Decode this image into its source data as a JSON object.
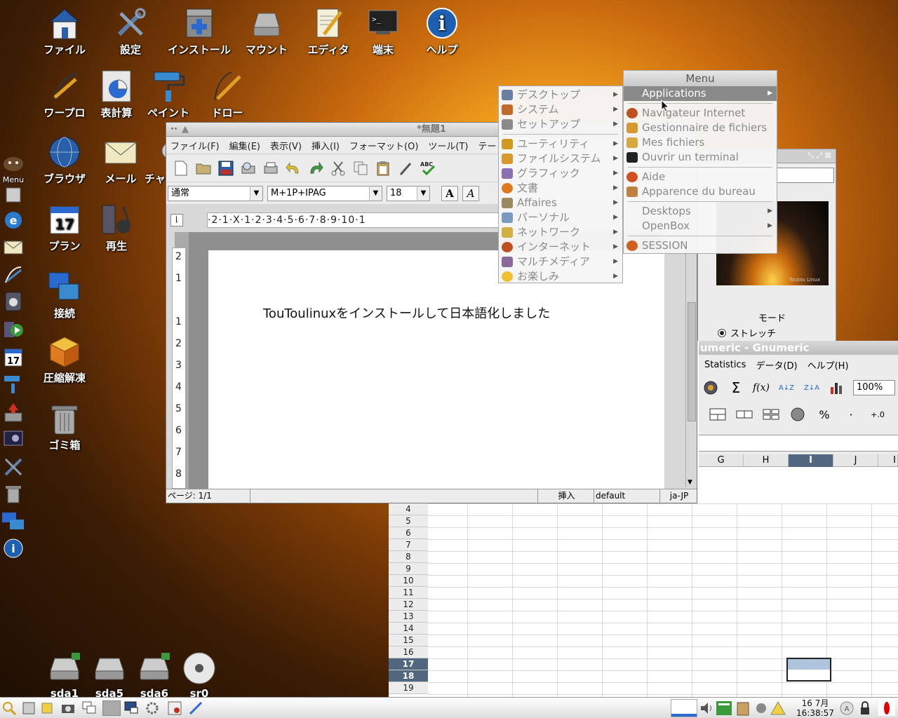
{
  "desktop": {
    "icons": [
      {
        "label": "ファイル"
      },
      {
        "label": "設定"
      },
      {
        "label": "インストール"
      },
      {
        "label": "マウント"
      },
      {
        "label": "エディタ"
      },
      {
        "label": "端末"
      },
      {
        "label": "ヘルプ"
      },
      {
        "label": "ワープロ"
      },
      {
        "label": "表計算"
      },
      {
        "label": "ペイント"
      },
      {
        "label": "ドロー"
      },
      {
        "label": "ブラウザ"
      },
      {
        "label": "メール"
      },
      {
        "label": "チャ"
      },
      {
        "label": "プラン"
      },
      {
        "label": "再生"
      },
      {
        "label": "接続"
      },
      {
        "label": "圧縮解凍"
      },
      {
        "label": "ゴミ箱"
      }
    ],
    "drives": [
      {
        "label": "sda1"
      },
      {
        "label": "sda5"
      },
      {
        "label": "sda6"
      },
      {
        "label": "sr0"
      }
    ],
    "dock_menu_label": "Menu",
    "calendar_day": "17"
  },
  "writer": {
    "title": "*無題1",
    "menu": [
      "ファイル(F)",
      "編集(E)",
      "表示(V)",
      "挿入(I)",
      "フォーマット(O)",
      "ツール(T)",
      "テー"
    ],
    "style": "通常",
    "font": "M+1P+IPAG",
    "size": "18",
    "bold_btn": "A",
    "italic_btn": "A",
    "ruler": "·2·1·X·1·2·3·4·5·6·7·8·9·10·1",
    "vruler": [
      "2",
      "1",
      "1",
      "2",
      "3",
      "4",
      "5",
      "6",
      "7",
      "8"
    ],
    "text": "TouToulinuxをインストールして日本語化しました",
    "status": {
      "page": "ページ: 1/1",
      "mode": "挿入",
      "style": "default",
      "lang": "ja-JP"
    }
  },
  "main_menu": {
    "title": "Menu",
    "items": [
      {
        "label": "Applications"
      },
      {
        "label": "Navigateur Internet"
      },
      {
        "label": "Gestionnaire de fichiers"
      },
      {
        "label": "Mes fichiers"
      },
      {
        "label": "Ouvrir un terminal"
      },
      {
        "label": "Aide"
      },
      {
        "label": "Apparence du bureau"
      },
      {
        "label": "Desktops"
      },
      {
        "label": "OpenBox"
      },
      {
        "label": "SESSION"
      }
    ]
  },
  "apps_menu": {
    "items": [
      {
        "label": "デスクトップ"
      },
      {
        "label": "システム"
      },
      {
        "label": "セットアップ"
      },
      {
        "label": "ユーティリティ"
      },
      {
        "label": "ファイルシステム"
      },
      {
        "label": "グラフィック"
      },
      {
        "label": "文書"
      },
      {
        "label": "Affaires"
      },
      {
        "label": "パーソナル"
      },
      {
        "label": "ネットワーク"
      },
      {
        "label": "インターネット"
      },
      {
        "label": "マルチメディア"
      },
      {
        "label": "お楽しみ"
      }
    ],
    "icon_colors": [
      "#6a7fa0",
      "#c06a2a",
      "#8a8a8a",
      "#d09a20",
      "#d89a30",
      "#8a70b0",
      "#e07a20",
      "#9a8a60",
      "#7a9ac0",
      "#d0b040",
      "#c05020",
      "#8a6a9a",
      "#f0c030"
    ]
  },
  "imgpanel": {
    "mode_label": "モード",
    "option": "ストレッチ",
    "preview_caption": "Toutou Linux"
  },
  "gnumeric": {
    "title": "umeric - Gnumeric",
    "menu": [
      "Statistics",
      "データ(D)",
      "ヘルプ(H)"
    ],
    "zoom": "100%",
    "columns": [
      "G",
      "H",
      "I",
      "J",
      "I"
    ],
    "rows": [
      "4",
      "5",
      "6",
      "7",
      "8",
      "9",
      "10",
      "11",
      "12",
      "13",
      "14",
      "15",
      "16",
      "17",
      "18",
      "19"
    ],
    "selected_rows": [
      "17",
      "18"
    ]
  },
  "taskbar": {
    "clock_date": "16 7月",
    "clock_time": "16:38:57"
  }
}
